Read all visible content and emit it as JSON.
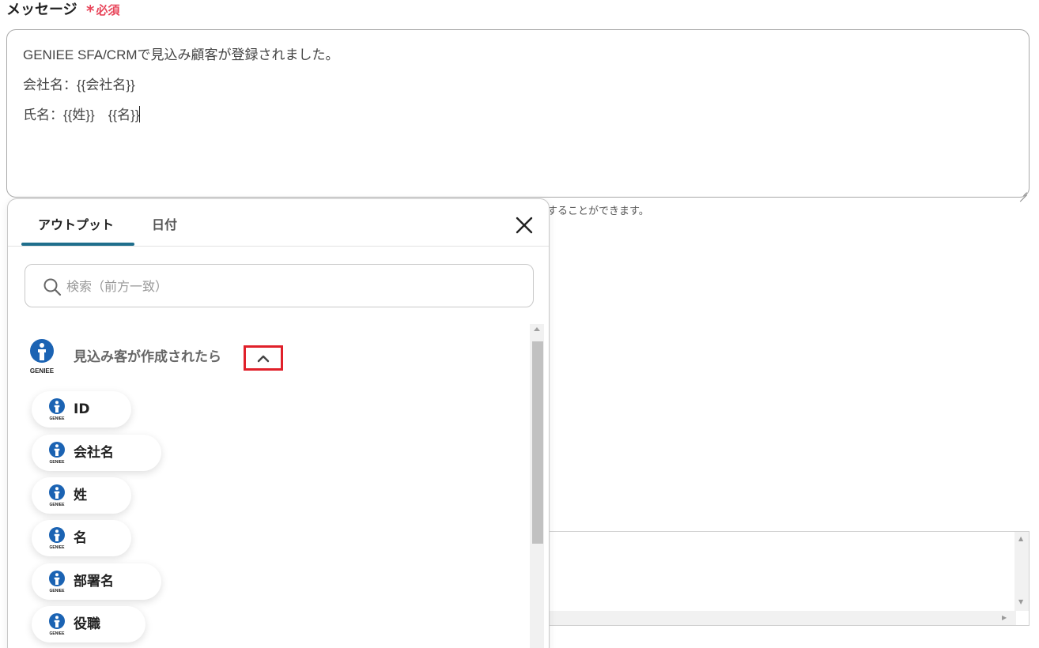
{
  "form": {
    "label": "メッセージ",
    "required_mark": "*",
    "required_text": "必須",
    "message_lines": [
      "GENIEE SFA/CRMで見込み顧客が登録されました。",
      "会社名：{{会社名}}",
      "氏名：{{姓}}　{{名}}"
    ],
    "help_text": "することができます。"
  },
  "popup": {
    "tabs": [
      {
        "label": "アウトプット",
        "active": true
      },
      {
        "label": "日付",
        "active": false
      }
    ],
    "search_placeholder": "検索（前方一致）",
    "section": {
      "title": "見込み客が作成されたら",
      "logo_text": "GENIEE",
      "expanded": true
    },
    "items": [
      {
        "label": "ID"
      },
      {
        "label": "会社名"
      },
      {
        "label": "姓"
      },
      {
        "label": "名"
      },
      {
        "label": "部署名"
      },
      {
        "label": "役職"
      }
    ]
  },
  "colors": {
    "accent": "#1f6e8c",
    "required": "#e8465b",
    "highlight": "#e0202a",
    "geniee_blue": "#1b63b3"
  }
}
